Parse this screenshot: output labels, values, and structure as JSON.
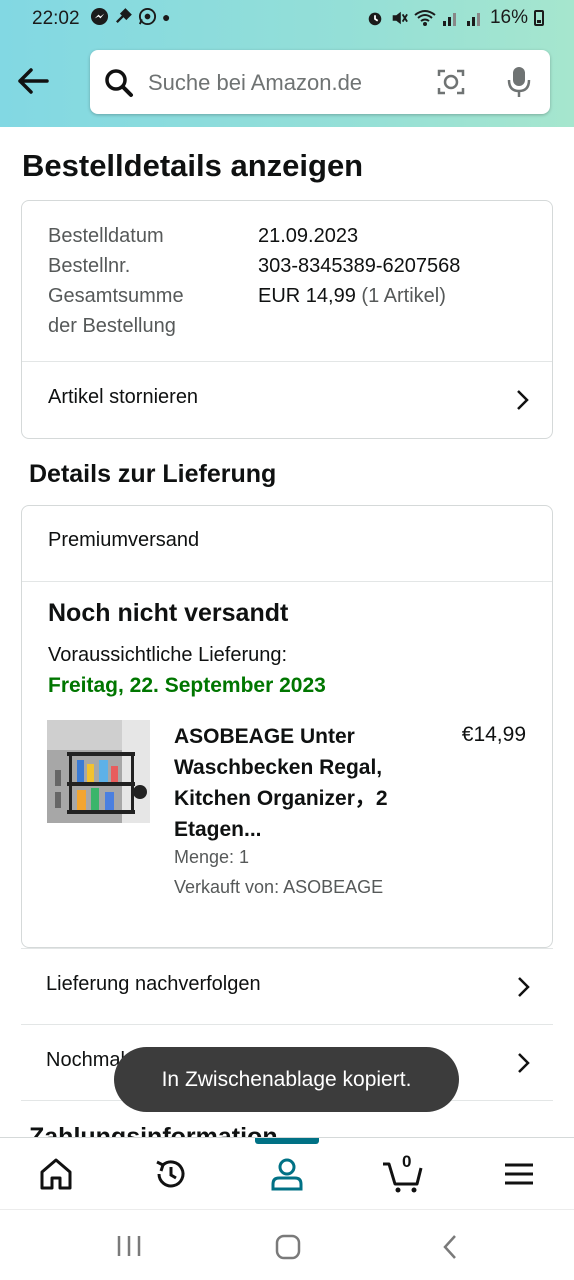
{
  "status": {
    "time": "22:02",
    "battery": "16%"
  },
  "search": {
    "placeholder": "Suche bei Amazon.de"
  },
  "page_title": "Bestelldetails anzeigen",
  "order": {
    "date_label": "Bestelldatum",
    "date_value": "21.09.2023",
    "number_label": "Bestellnr.",
    "number_value": "303-8345389-6207568",
    "total_label_line1": "Gesamtsumme",
    "total_label_line2": "der Bestellung",
    "total_value": "EUR 14,99",
    "total_count": "(1 Artikel)",
    "cancel_label": "Artikel stornieren"
  },
  "delivery": {
    "section_title": "Details zur Lieferung",
    "shipping_method": "Premiumversand",
    "status": "Noch nicht versandt",
    "expected_label": "Voraussichtliche Lieferung:",
    "expected_date": "Freitag, 22. September 2023",
    "product": {
      "title": "ASOBEAGE Unter Waschbecken Regal, Kitchen Organizer，2 Etagen...",
      "price": "€14,99",
      "quantity": "Menge: 1",
      "seller": "Verkauft von: ASOBEAGE"
    }
  },
  "actions": {
    "track": "Lieferung nachverfolgen",
    "buy_again": "Nochmals kaufen"
  },
  "next_section_title": "Zahlungsinformation",
  "toast": "In Zwischenablage kopiert.",
  "bottom_nav": {
    "cart_count": "0",
    "active_item": "account"
  },
  "colors": {
    "header_gradient_start": "#82d8e3",
    "header_gradient_end": "#a6e6ce",
    "delivery_green": "#007600",
    "nav_active": "#007185"
  }
}
